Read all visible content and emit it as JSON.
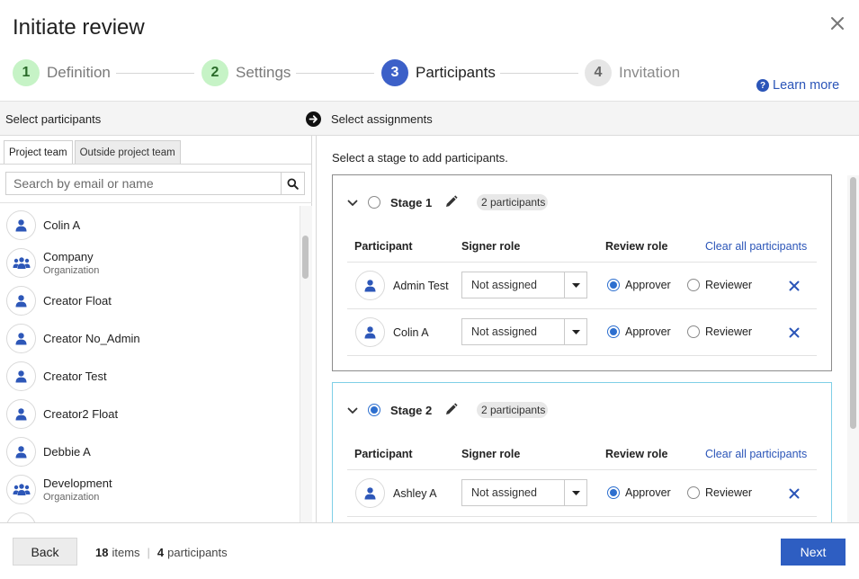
{
  "dialog": {
    "title": "Initiate review"
  },
  "steps": [
    {
      "num": "1",
      "label": "Definition"
    },
    {
      "num": "2",
      "label": "Settings"
    },
    {
      "num": "3",
      "label": "Participants"
    },
    {
      "num": "4",
      "label": "Invitation"
    }
  ],
  "learn_more": "Learn more",
  "left": {
    "header": "Select participants",
    "tabs": [
      "Project team",
      "Outside project team"
    ],
    "search_placeholder": "Search by email or name",
    "people": [
      {
        "name": "Colin A",
        "sub": ""
      },
      {
        "name": "Company",
        "sub": "Organization"
      },
      {
        "name": "Creator Float",
        "sub": ""
      },
      {
        "name": "Creator No_Admin",
        "sub": ""
      },
      {
        "name": "Creator Test",
        "sub": ""
      },
      {
        "name": "Creator2 Float",
        "sub": ""
      },
      {
        "name": "Debbie A",
        "sub": ""
      },
      {
        "name": "Development",
        "sub": "Organization"
      }
    ]
  },
  "right": {
    "header": "Select assignments",
    "hint": "Select a stage to add participants.",
    "columns": {
      "participant": "Participant",
      "signer": "Signer role",
      "review": "Review role",
      "clear": "Clear all participants"
    },
    "role_labels": {
      "approver": "Approver",
      "reviewer": "Reviewer"
    },
    "stages": [
      {
        "title": "Stage 1",
        "count": "2 participants",
        "selected": false,
        "rows": [
          {
            "name": "Admin Test",
            "signer": "Not assigned",
            "role": "Approver"
          },
          {
            "name": "Colin A",
            "signer": "Not assigned",
            "role": "Approver"
          }
        ]
      },
      {
        "title": "Stage 2",
        "count": "2 participants",
        "selected": true,
        "rows": [
          {
            "name": "Ashley A",
            "signer": "Not assigned",
            "role": "Approver"
          }
        ]
      }
    ]
  },
  "footer": {
    "back": "Back",
    "items_count": "18",
    "items_label": "items",
    "separator": "|",
    "participants_count": "4",
    "participants_label": "participants",
    "next": "Next"
  },
  "colors": {
    "accent": "#2e5ec2",
    "link": "#2b55b8",
    "step_done": "#c6f3c6",
    "selected_stage": "#7fcfe6"
  }
}
